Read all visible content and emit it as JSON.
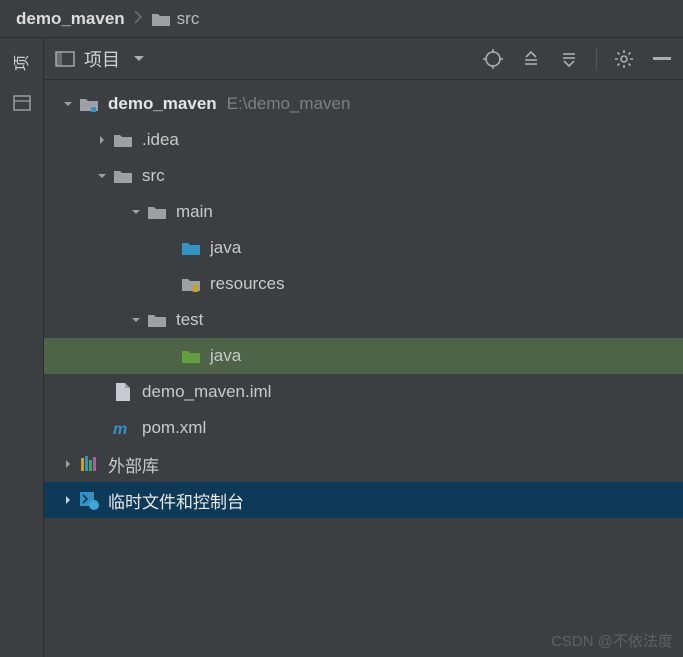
{
  "breadcrumb": {
    "project": "demo_maven",
    "current": "src"
  },
  "toolbar": {
    "title": "项目"
  },
  "tree": {
    "root": {
      "label": "demo_maven",
      "path": "E:\\demo_maven"
    },
    "idea": {
      "label": ".idea"
    },
    "src": {
      "label": "src"
    },
    "main": {
      "label": "main"
    },
    "main_java": {
      "label": "java"
    },
    "main_resources": {
      "label": "resources"
    },
    "test": {
      "label": "test"
    },
    "test_java": {
      "label": "java"
    },
    "iml": {
      "label": "demo_maven.iml"
    },
    "pom": {
      "label": "pom.xml"
    },
    "ext_libs": {
      "label": "外部库"
    },
    "scratches": {
      "label": "临时文件和控制台"
    }
  },
  "watermark": "CSDN @不依法度"
}
